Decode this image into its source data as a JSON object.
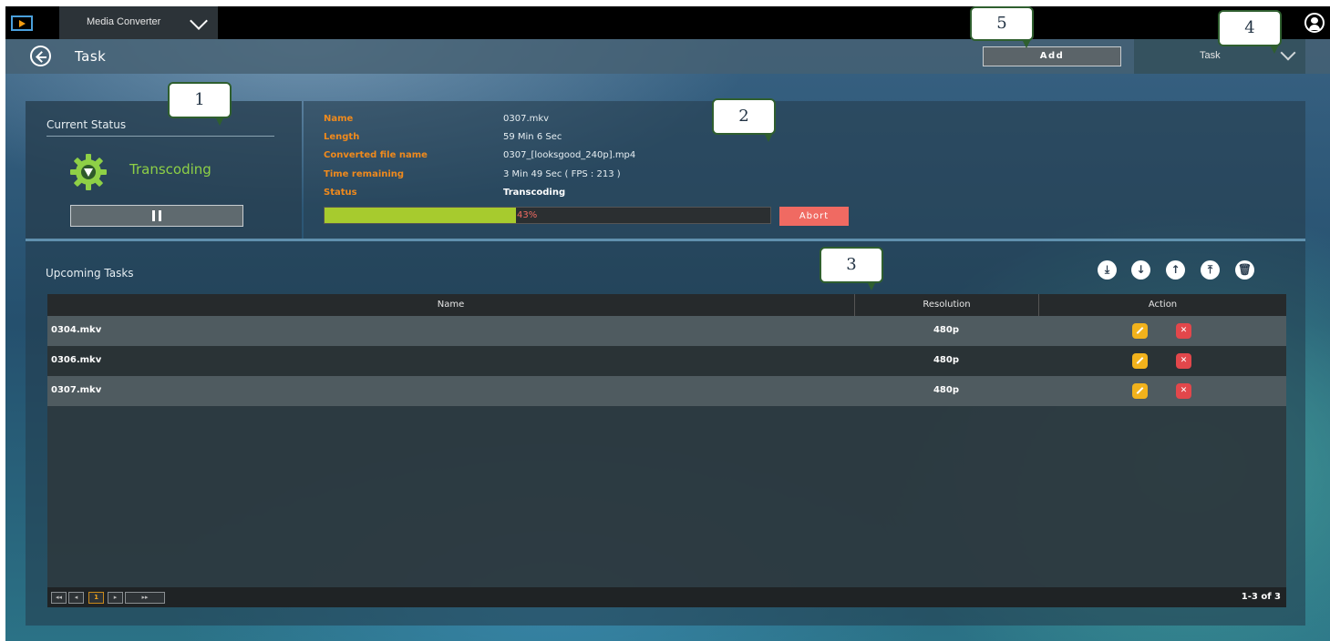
{
  "topbar": {
    "app_name": "Media Converter"
  },
  "header": {
    "title": "Task",
    "add_label": "Add",
    "view_select": "Task"
  },
  "current_status": {
    "title": "Current Status",
    "state": "Transcoding",
    "status_color": "#8ed046"
  },
  "details": {
    "labels": {
      "name": "Name",
      "length": "Length",
      "converted": "Converted file name",
      "remaining": "Time remaining",
      "status": "Status"
    },
    "values": {
      "name": "0307.mkv",
      "length": "59 Min 6 Sec",
      "converted": "0307_[looksgood_240p].mp4",
      "remaining": "3 Min 49 Sec  ( FPS : 213 )",
      "status": "Transcoding"
    },
    "progress_percent": 43,
    "progress_label": "43%",
    "abort_label": "Abort"
  },
  "upcoming": {
    "title": "Upcoming Tasks",
    "columns": {
      "name": "Name",
      "resolution": "Resolution",
      "action": "Action"
    },
    "rows": [
      {
        "name": "0304.mkv",
        "resolution": "480p"
      },
      {
        "name": "0306.mkv",
        "resolution": "480p"
      },
      {
        "name": "0307.mkv",
        "resolution": "480p"
      }
    ],
    "pagination": {
      "current_page": "1",
      "count": "1-3 of 3"
    }
  },
  "callouts": [
    "1",
    "2",
    "3",
    "4",
    "5"
  ],
  "colors": {
    "accent_orange": "#f08a1c",
    "progress_green": "#a7cb2e",
    "abort_red": "#f06a62"
  }
}
